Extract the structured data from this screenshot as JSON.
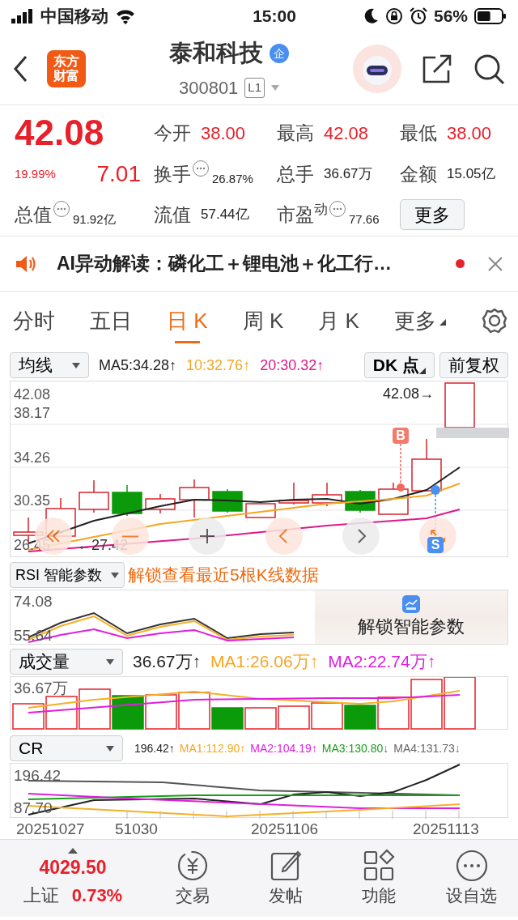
{
  "status_bar": {
    "carrier": "中国移动",
    "time": "15:00",
    "battery": "56%"
  },
  "header": {
    "logo": [
      "东方",
      "财富"
    ],
    "title": "泰和科技",
    "badge": "企",
    "code": "300801",
    "level_tag": "L1"
  },
  "quote": {
    "price": "42.08",
    "change_pct": "19.99%",
    "change": "7.01",
    "more_button": "更多",
    "stats": [
      {
        "label": "今开",
        "value": "38.00",
        "color": "#e8202a",
        "kind": "plain"
      },
      {
        "label": "最高",
        "value": "42.08",
        "color": "#e8202a",
        "kind": "plain"
      },
      {
        "label": "最低",
        "value": "38.00",
        "color": "#e8202a",
        "kind": "plain"
      },
      {
        "label": "换手",
        "value": "26.87%",
        "color": "#222222",
        "kind": "info"
      },
      {
        "label": "总手",
        "value": "36.67万",
        "color": "#222222",
        "kind": "plain"
      },
      {
        "label": "金额",
        "value": "15.05亿",
        "color": "#222222",
        "kind": "plain"
      },
      {
        "label": "总值",
        "value": "91.92亿",
        "color": "#222222",
        "kind": "info"
      },
      {
        "label": "流值",
        "value": "57.44亿",
        "color": "#222222",
        "kind": "plain"
      },
      {
        "label": "市盈$^{动}$",
        "value": "77.66",
        "color": "#222222",
        "kind": "info"
      }
    ]
  },
  "ai_banner": {
    "text": "AI异动解读：磷化工＋锂电池＋化工行…",
    "unread": true
  },
  "period_tabs": [
    {
      "label": "分时",
      "selected": false,
      "kind": "tab"
    },
    {
      "label": "五日",
      "selected": false,
      "kind": "tab"
    },
    {
      "label": "日 K",
      "selected": true,
      "kind": "tab"
    },
    {
      "label": "周 K",
      "selected": false,
      "kind": "tab"
    },
    {
      "label": "月 K",
      "selected": false,
      "kind": "tab"
    },
    {
      "label": "更多",
      "selected": false,
      "kind": "menu"
    }
  ],
  "kline": {
    "indicator": "均线",
    "ma": [
      {
        "text": "MA5:34.28↑",
        "color": "#222222"
      },
      {
        "text": "10:32.76↑",
        "color": "#f5a623"
      },
      {
        "text": "20:30.32↑",
        "color": "#e0188a"
      }
    ],
    "dk_button": "DK 点",
    "adjust_button": "前复权",
    "axis": [
      "42.08",
      "38.17",
      "34.26",
      "30.35",
      "26.45"
    ],
    "high_label": "42.08→",
    "low_label": "←27.42",
    "buy_marker": "B",
    "sell_marker": "S"
  },
  "rsi": {
    "indicator": "RSI 智能参数",
    "promo": "解锁查看最近5根K线数据",
    "axis": [
      "74.08",
      "55.64"
    ],
    "unlock": "解锁智能参数"
  },
  "volume": {
    "indicator": "成交量",
    "axis": [
      "36.67万"
    ],
    "values": [
      {
        "text": "36.67万↑",
        "color": "#222222"
      },
      {
        "text": "MA1:26.06万↑",
        "color": "#f5a623"
      },
      {
        "text": "MA2:22.74万↑",
        "color": "#e01ee0"
      }
    ]
  },
  "cr": {
    "indicator": "CR",
    "axis": [
      "196.42",
      "87.70"
    ],
    "values": [
      {
        "text": "196.42↑",
        "color": "#222222"
      },
      {
        "text": "MA1:112.90↑",
        "color": "#f5a623"
      },
      {
        "text": "MA2:104.19↑",
        "color": "#e01ee0"
      },
      {
        "text": "MA3:130.80↓",
        "color": "#1a9e1a"
      },
      {
        "text": "MA4:131.73↓",
        "color": "#666666"
      }
    ]
  },
  "dates": [
    "20251027",
    "51030",
    "20251106",
    "20251113"
  ],
  "bottom_bar": {
    "index_value": "4029.50",
    "index_name": "上证",
    "index_change": "0.73%",
    "items": [
      {
        "label": "交易",
        "kind": "trade"
      },
      {
        "label": "发帖",
        "kind": "post"
      },
      {
        "label": "功能",
        "kind": "apps"
      },
      {
        "label": "设自选",
        "kind": "more"
      }
    ]
  }
}
